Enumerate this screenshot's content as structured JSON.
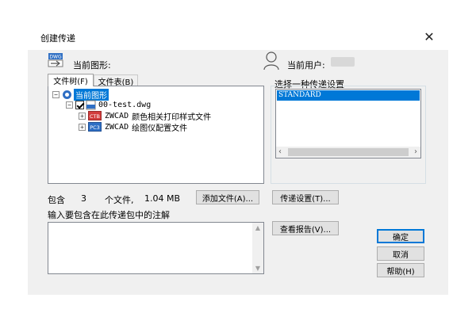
{
  "window": {
    "title": "创建传递"
  },
  "current_drawing": {
    "label": "当前图形:"
  },
  "current_user": {
    "label": "当前用户:",
    "value": ""
  },
  "tabs": [
    {
      "label": "文件树(F)"
    },
    {
      "label": "文件表(B)"
    }
  ],
  "tree": {
    "root": "当前图形",
    "file": "00-test.dwg",
    "children": [
      {
        "prefix": "ZWCAD",
        "label": "颜色相关打印样式文件"
      },
      {
        "prefix": "ZWCAD",
        "label": "绘图仪配置文件"
      }
    ]
  },
  "icons": {
    "dwg_badge": "DWG",
    "ctb_badge": "CTB",
    "pc3_badge": "PC3"
  },
  "summary": {
    "prefix": "包含",
    "count": "3",
    "files_text": "个文件,",
    "size": "1.04 MB"
  },
  "buttons": {
    "add_file": "添加文件(A)...",
    "transmittal_setup": "传递设置(T)...",
    "view_report": "查看报告(V)...",
    "ok": "确定",
    "cancel": "取消",
    "help": "帮助(H)"
  },
  "setups": {
    "label": "选择一种传递设置",
    "items": [
      "STANDARD"
    ]
  },
  "notes": {
    "label": "输入要包含在此传递包中的注解",
    "value": ""
  },
  "colors": {
    "accent": "#0078d7",
    "dialog_bg": "#f0f0f0",
    "ctb_red": "#d23c3c",
    "pc3_blue": "#2f6fc4"
  }
}
